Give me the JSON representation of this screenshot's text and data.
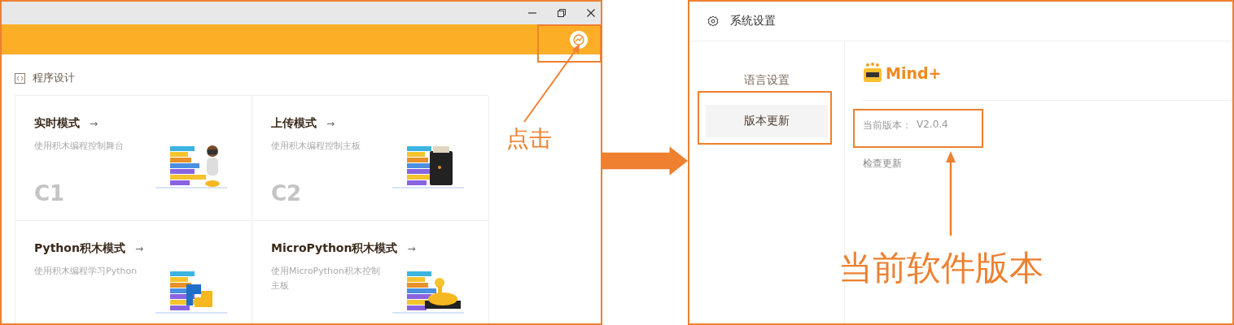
{
  "main_window": {
    "section_title": "程序设计",
    "modes": [
      {
        "title": "实时模式",
        "arrow": "→",
        "description": "使用积木编程控制舞台",
        "code": "C1",
        "kind": "robot"
      },
      {
        "title": "上传模式",
        "arrow": "→",
        "description": "使用积木编程控制主板",
        "code": "C2",
        "kind": "board"
      },
      {
        "title": "Python积木模式",
        "arrow": "→",
        "description": "使用积木编程学习Python",
        "kind": "python"
      },
      {
        "title": "MicroPython积木模式",
        "arrow": "→",
        "description": "使用MicroPython积木控制主板",
        "kind": "snake"
      }
    ]
  },
  "settings_window": {
    "title": "系统设置",
    "menu": [
      {
        "label": "语言设置",
        "selected": false
      },
      {
        "label": "版本更新",
        "selected": true
      }
    ],
    "product": "Mind+",
    "version_label": "当前版本：",
    "version": "V2.0.4",
    "check_update": "检查更新"
  },
  "annotations": {
    "click_note": "点击",
    "version_note": "当前软件版本"
  }
}
